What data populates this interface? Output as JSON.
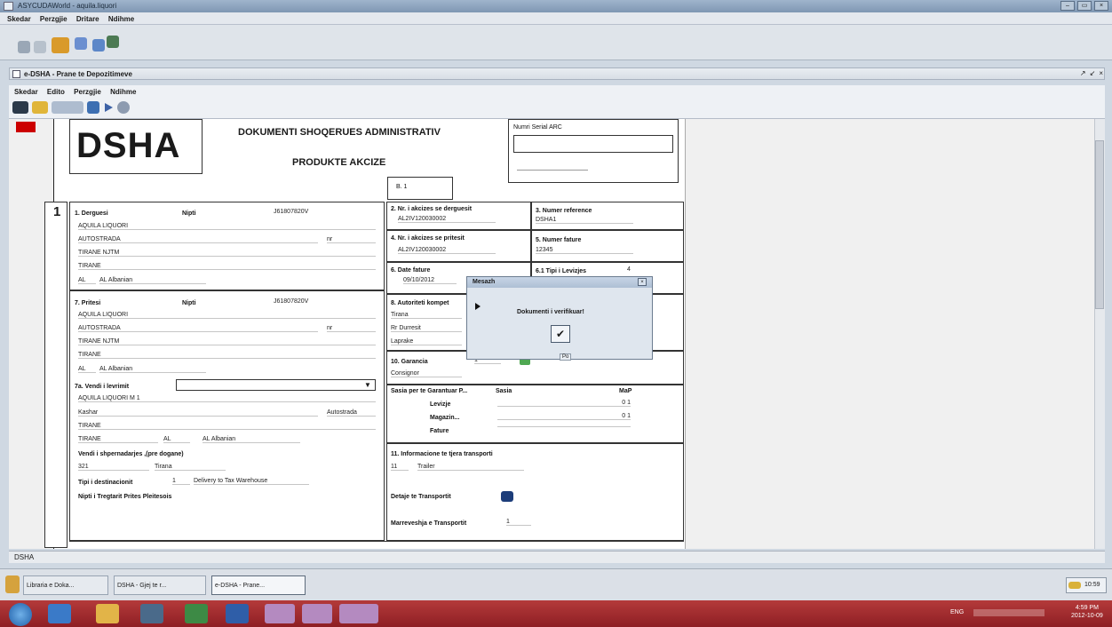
{
  "outer_window": {
    "title": "ASYCUDAWorld - aquila.liquori",
    "controls": [
      "–",
      "▭",
      "×"
    ]
  },
  "outer_menu": [
    "Skedar",
    "Perzgjie",
    "Dritare",
    "Ndihme"
  ],
  "inner_window": {
    "title": "e-DSHA - Prane te Depozitimeve",
    "controls": [
      "↗",
      "↙",
      "×"
    ]
  },
  "inner_menu": [
    "Skedar",
    "Edito",
    "Perzgjie",
    "Ndihme"
  ],
  "form": {
    "logo": "DSHA",
    "title": "DOKUMENTI SHOQERUES ADMINISTRATIV",
    "subtitle": "PRODUKTE AKCIZE",
    "serial_label": "Numri Serial ARC",
    "page_ref": "B. 1",
    "section_number": "1",
    "box1": {
      "label": "1. Derguesi",
      "nipt_label": "Nipti",
      "nipt": "J61807820V",
      "name": "AQUILA LIQUORI",
      "street": "AUTOSTRADA",
      "street_no": "nr",
      "city": "TIRANE NJTM",
      "region": "TIRANE",
      "country_code": "AL",
      "country": "AL Albanian"
    },
    "box2": {
      "label": "2. Nr. i akcizes se derguesit",
      "value": "AL2IV120030002"
    },
    "box3": {
      "label": "3. Numer reference",
      "value": "DSHA1"
    },
    "box4": {
      "label": "4. Nr. i akcizes se pritesit",
      "value": "AL2IV120030002"
    },
    "box5": {
      "label": "5. Numer fature",
      "value": "12345"
    },
    "box6": {
      "label": "6. Date fature",
      "value": "09/10/2012"
    },
    "box61": {
      "label": "6.1 Tipi i Levizjes",
      "value": "4"
    },
    "box7": {
      "label": "7. Pritesi",
      "nipt_label": "Nipti",
      "nipt": "J61807820V",
      "name": "AQUILA LIQUORI",
      "street": "AUTOSTRADA",
      "street_no": "nr",
      "city": "TIRANE NJTM",
      "region": "TIRANE",
      "country_code": "AL",
      "country": "AL Albanian"
    },
    "box7a": {
      "label": "7a. Vendi i levrimit",
      "name": "AQUILA LIQUORI M 1",
      "street": "Kashar",
      "street2": "Autostrada",
      "city": "TIRANE",
      "region": "TIRANE",
      "country_code": "AL",
      "country": "AL Albanian"
    },
    "origin": {
      "label": "Vendi i shpernadarjes ,(pre dogane)",
      "code": "321",
      "city": "Tirana"
    },
    "destination": {
      "label": "Tipi i destinacionit",
      "code": "1",
      "value": "Delivery to Tax Warehouse"
    },
    "carrier_label": "Nipti i Tregtarit Prites Pleitesois",
    "box8": {
      "label": "8. Autoriteti kompet",
      "lines": [
        "Tirana",
        "Rr Durresit",
        "Laprake"
      ]
    },
    "box10": {
      "label": "10. Garancia",
      "value": "1",
      "sub": "Consignor"
    },
    "guarantee": {
      "label": "Sasia per te Garantuar P...",
      "col1": "Sasia",
      "col2": "MaP",
      "rows": [
        {
          "label": "Levizje",
          "value": "0 1"
        },
        {
          "label": "Magazin...",
          "value": "0 1"
        },
        {
          "label": "Fature",
          "value": ""
        }
      ]
    },
    "box11": {
      "label": "11. Informacione te tjera transporti",
      "code": "11",
      "value": "Trailer"
    },
    "transport_details": "Detaje te Transportit",
    "transport_org": {
      "label": "Marreveshja e Transportit",
      "value": "1"
    }
  },
  "dialog": {
    "title": "Mesazh",
    "message": "Dokumenti i verifikuar!",
    "ok": "✔",
    "button_caption": "Po"
  },
  "status": {
    "text": "DSHA"
  },
  "app_tasks": [
    "Libraria e Doka...",
    "DSHA - Gjej te r...",
    "e-DSHA - Prane..."
  ],
  "key_caption": "10:59",
  "tray": {
    "lang": "ENG",
    "time": "4:59 PM",
    "date": "2012-10-09"
  },
  "colors": {
    "titlebar": "#8aa1bd",
    "taskbar": "#a2282c",
    "flag": "#cc0000"
  }
}
